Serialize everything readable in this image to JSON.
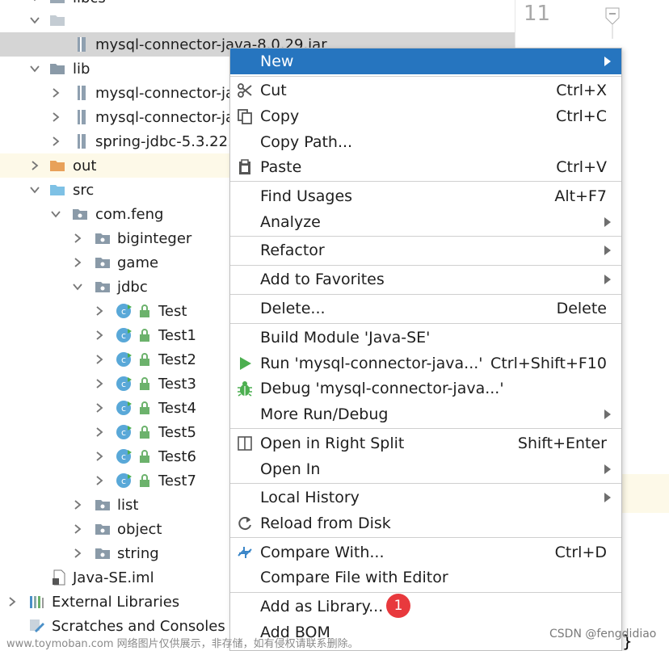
{
  "tree": {
    "top_label": "libcs",
    "rows": [
      {
        "label": "mysql-connector-java-8.0.29.jar"
      },
      {
        "label": "lib"
      },
      {
        "label": "mysql-connector-ja"
      },
      {
        "label": "mysql-connector-ja"
      },
      {
        "label": "spring-jdbc-5.3.22."
      },
      {
        "label": "out"
      },
      {
        "label": "src"
      },
      {
        "label": "com.feng"
      },
      {
        "label": "biginteger"
      },
      {
        "label": "game"
      },
      {
        "label": "jdbc"
      },
      {
        "label": "Test"
      },
      {
        "label": "Test1"
      },
      {
        "label": "Test2"
      },
      {
        "label": "Test3"
      },
      {
        "label": "Test4"
      },
      {
        "label": "Test5"
      },
      {
        "label": "Test6"
      },
      {
        "label": "Test7"
      },
      {
        "label": "list"
      },
      {
        "label": "object"
      },
      {
        "label": "string"
      },
      {
        "label": "Java-SE.iml"
      },
      {
        "label": "External Libraries"
      },
      {
        "label": "Scratches and Consoles"
      }
    ]
  },
  "editor": {
    "line_number": "11",
    "brace": "}"
  },
  "menu": {
    "new": "New",
    "cut": "Cut",
    "cut_key": "Ctrl+X",
    "copy": "Copy",
    "copy_key": "Ctrl+C",
    "copy_path": "Copy Path...",
    "paste": "Paste",
    "paste_key": "Ctrl+V",
    "find_usages": "Find Usages",
    "find_usages_key": "Alt+F7",
    "analyze": "Analyze",
    "refactor": "Refactor",
    "add_to_favorites": "Add to Favorites",
    "delete": "Delete...",
    "delete_key": "Delete",
    "build_module": "Build Module 'Java-SE'",
    "run": "Run 'mysql-connector-java...'",
    "run_key": "Ctrl+Shift+F10",
    "debug": "Debug 'mysql-connector-java...'",
    "more_run": "More Run/Debug",
    "open_right_split": "Open in Right Split",
    "open_right_split_key": "Shift+Enter",
    "open_in": "Open In",
    "local_history": "Local History",
    "reload": "Reload from Disk",
    "compare_with": "Compare With...",
    "compare_with_key": "Ctrl+D",
    "compare_file": "Compare File with Editor",
    "add_as_library": "Add as Library...",
    "add_bom": "Add BOM"
  },
  "badge": "1",
  "watermark": {
    "left": "www.toymoban.com 网络图片仅供展示，非存储，如有侵权请联系删除。",
    "right": "CSDN @fengdidiao"
  },
  "colors": {
    "accent": "#2675bf",
    "badge": "#e8393d",
    "folder": "#8a9aa8",
    "out_folder": "#e8a15a",
    "src_folder": "#7ec1e5",
    "run": "#4caf50"
  }
}
